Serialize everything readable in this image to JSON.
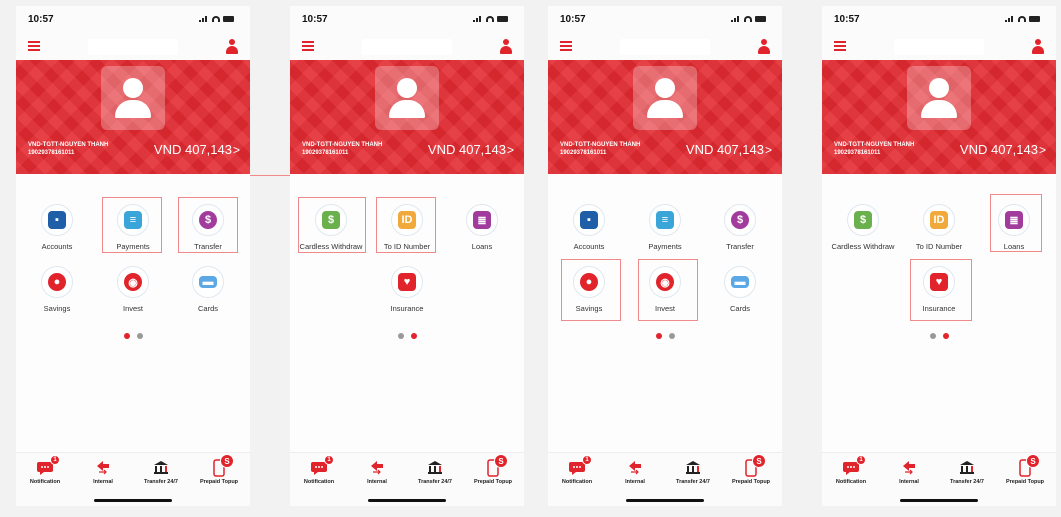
{
  "status": {
    "time": "10:57"
  },
  "account": {
    "name": "VND-TGTT-NGUYEN THANH",
    "number": "19029378161011",
    "balance": "VND 407,143",
    "chevron": ">"
  },
  "labels": {
    "accounts": "Accounts",
    "payments": "Payments",
    "transfer": "Transfer",
    "savings": "Savings",
    "invest": "Invest",
    "cards": "Cards",
    "cardless": "Cardless Withdraw",
    "to_id": "To ID Number",
    "loans": "Loans",
    "insurance": "Insurance"
  },
  "tabs": {
    "notification": "Notification",
    "internal": "Internal",
    "transfer247": "Transfer 24/7",
    "prepaid": "Prepaid Topup",
    "notification_badge": "1",
    "prepaid_badge": "S"
  },
  "icons": {
    "accounts": "wallet-icon",
    "payments": "bill-icon",
    "transfer": "transfer-icon",
    "savings": "piggy-bank-icon",
    "invest": "invest-icon",
    "cards": "card-icon",
    "cardless": "cash-withdraw-icon",
    "to_id": "id-card-icon",
    "loans": "loan-document-icon",
    "insurance": "shield-icon"
  },
  "colors": {
    "brand_red": "#e1232b",
    "banner_red": "#e32a31",
    "highlight": "#f08a8a"
  },
  "screens": [
    {
      "page": 1,
      "active_dot": 1,
      "highlighted": [
        "payments",
        "transfer"
      ]
    },
    {
      "page": 2,
      "active_dot": 2,
      "highlighted": [
        "cardless",
        "to_id"
      ]
    },
    {
      "page": 1,
      "active_dot": 1,
      "highlighted": [
        "savings",
        "invest"
      ]
    },
    {
      "page": 2,
      "active_dot": 2,
      "highlighted": [
        "loans",
        "insurance"
      ]
    }
  ]
}
